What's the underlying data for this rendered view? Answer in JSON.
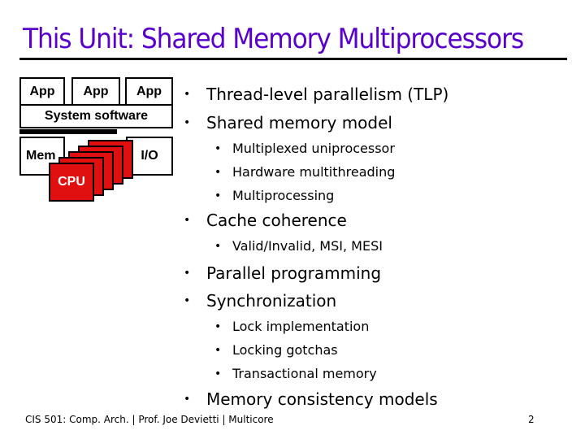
{
  "slide": {
    "title": "This Unit: Shared Memory Multiprocessors",
    "title_color": "#5a00cc",
    "diagram": {
      "apps": [
        "App",
        "App",
        "App"
      ],
      "system_software": "System software",
      "memory": "Mem",
      "io": "I/O",
      "cpu": "CPU",
      "cpu_color": "#e01010",
      "cpu_stack_count": 5
    },
    "bullets": [
      {
        "level": 1,
        "text": "Thread-level parallelism (TLP)"
      },
      {
        "level": 1,
        "text": "Shared memory model"
      },
      {
        "level": 2,
        "text": "Multiplexed uniprocessor"
      },
      {
        "level": 2,
        "text": "Hardware multithreading"
      },
      {
        "level": 2,
        "text": "Multiprocessing"
      },
      {
        "level": 1,
        "text": "Cache coherence"
      },
      {
        "level": 2,
        "text": "Valid/Invalid, MSI, MESI"
      },
      {
        "level": 1,
        "text": "Parallel programming"
      },
      {
        "level": 1,
        "text": "Synchronization"
      },
      {
        "level": 2,
        "text": "Lock implementation"
      },
      {
        "level": 2,
        "text": "Locking gotchas"
      },
      {
        "level": 2,
        "text": "Transactional memory"
      },
      {
        "level": 1,
        "text": "Memory consistency models"
      }
    ],
    "bullet_glyph": "•",
    "footer": {
      "left": "CIS 501: Comp. Arch.  |  Prof. Joe Devietti  |  Multicore",
      "page_number": "2"
    }
  }
}
